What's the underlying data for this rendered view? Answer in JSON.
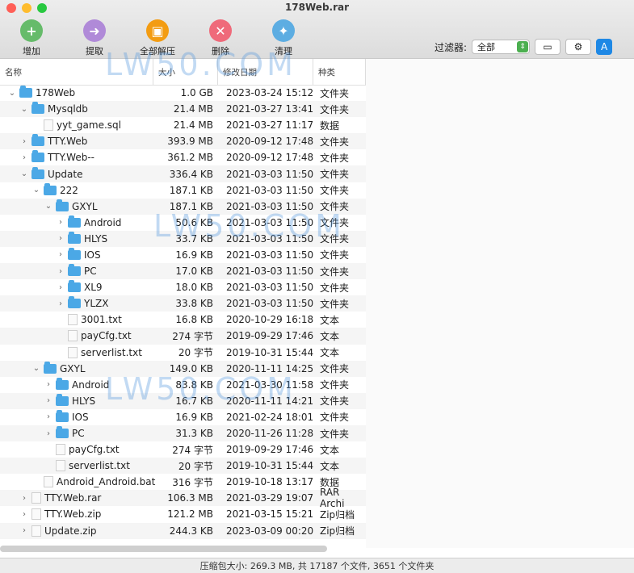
{
  "window": {
    "title": "178Web.rar"
  },
  "toolbar": {
    "items": [
      {
        "label": "增加",
        "icon": "add-icon",
        "color": "#66bb6a"
      },
      {
        "label": "提取",
        "icon": "extract-icon",
        "color": "#b08ad8"
      },
      {
        "label": "全部解压",
        "icon": "extract-all-icon",
        "color": "#f39c12"
      },
      {
        "label": "删除",
        "icon": "delete-icon",
        "color": "#ef6a7a"
      },
      {
        "label": "清理",
        "icon": "clean-icon",
        "color": "#5dade2"
      }
    ]
  },
  "filter": {
    "label": "过滤器:",
    "value": "全部"
  },
  "table": {
    "headers": [
      "名称",
      "大小",
      "修改日期",
      "种类"
    ],
    "rows": [
      {
        "name": "178Web",
        "size": "1.0 GB",
        "date": "2023-03-24 15:12",
        "type": "文件夹",
        "depth": 0,
        "kind": "folder",
        "chevron": "v"
      },
      {
        "name": "Mysqldb",
        "size": "21.4 MB",
        "date": "2021-03-27 13:41",
        "type": "文件夹",
        "depth": 1,
        "kind": "folder",
        "chevron": "v"
      },
      {
        "name": "yyt_game.sql",
        "size": "21.4 MB",
        "date": "2021-03-27 11:17",
        "type": "数据",
        "depth": 2,
        "kind": "file",
        "chevron": ""
      },
      {
        "name": "TTY.Web",
        "size": "393.9 MB",
        "date": "2020-09-12 17:48",
        "type": "文件夹",
        "depth": 1,
        "kind": "folder",
        "chevron": ">"
      },
      {
        "name": "TTY.Web--",
        "size": "361.2 MB",
        "date": "2020-09-12 17:48",
        "type": "文件夹",
        "depth": 1,
        "kind": "folder",
        "chevron": ">"
      },
      {
        "name": "Update",
        "size": "336.4 KB",
        "date": "2021-03-03 11:50",
        "type": "文件夹",
        "depth": 1,
        "kind": "folder",
        "chevron": "v"
      },
      {
        "name": "222",
        "size": "187.1 KB",
        "date": "2021-03-03 11:50",
        "type": "文件夹",
        "depth": 2,
        "kind": "folder",
        "chevron": "v"
      },
      {
        "name": "GXYL",
        "size": "187.1 KB",
        "date": "2021-03-03 11:50",
        "type": "文件夹",
        "depth": 3,
        "kind": "folder",
        "chevron": "v"
      },
      {
        "name": "Android",
        "size": "50.6 KB",
        "date": "2021-03-03 11:50",
        "type": "文件夹",
        "depth": 4,
        "kind": "folder",
        "chevron": ">"
      },
      {
        "name": "HLYS",
        "size": "33.7 KB",
        "date": "2021-03-03 11:50",
        "type": "文件夹",
        "depth": 4,
        "kind": "folder",
        "chevron": ">"
      },
      {
        "name": "IOS",
        "size": "16.9 KB",
        "date": "2021-03-03 11:50",
        "type": "文件夹",
        "depth": 4,
        "kind": "folder",
        "chevron": ">"
      },
      {
        "name": "PC",
        "size": "17.0 KB",
        "date": "2021-03-03 11:50",
        "type": "文件夹",
        "depth": 4,
        "kind": "folder",
        "chevron": ">"
      },
      {
        "name": "XL9",
        "size": "18.0 KB",
        "date": "2021-03-03 11:50",
        "type": "文件夹",
        "depth": 4,
        "kind": "folder",
        "chevron": ">"
      },
      {
        "name": "YLZX",
        "size": "33.8 KB",
        "date": "2021-03-03 11:50",
        "type": "文件夹",
        "depth": 4,
        "kind": "folder",
        "chevron": ">"
      },
      {
        "name": "3001.txt",
        "size": "16.8 KB",
        "date": "2020-10-29 16:18",
        "type": "文本",
        "depth": 4,
        "kind": "file",
        "chevron": ""
      },
      {
        "name": "payCfg.txt",
        "size": "274 字节",
        "date": "2019-09-29 17:46",
        "type": "文本",
        "depth": 4,
        "kind": "file",
        "chevron": ""
      },
      {
        "name": "serverlist.txt",
        "size": "20 字节",
        "date": "2019-10-31 15:44",
        "type": "文本",
        "depth": 4,
        "kind": "file",
        "chevron": ""
      },
      {
        "name": "GXYL",
        "size": "149.0 KB",
        "date": "2020-11-11 14:25",
        "type": "文件夹",
        "depth": 2,
        "kind": "folder",
        "chevron": "v"
      },
      {
        "name": "Android",
        "size": "83.8 KB",
        "date": "2021-03-30 11:58",
        "type": "文件夹",
        "depth": 3,
        "kind": "folder",
        "chevron": ">"
      },
      {
        "name": "HLYS",
        "size": "16.7 KB",
        "date": "2020-11-11 14:21",
        "type": "文件夹",
        "depth": 3,
        "kind": "folder",
        "chevron": ">"
      },
      {
        "name": "IOS",
        "size": "16.9 KB",
        "date": "2021-02-24 18:01",
        "type": "文件夹",
        "depth": 3,
        "kind": "folder",
        "chevron": ">"
      },
      {
        "name": "PC",
        "size": "31.3 KB",
        "date": "2020-11-26 11:28",
        "type": "文件夹",
        "depth": 3,
        "kind": "folder",
        "chevron": ">"
      },
      {
        "name": "payCfg.txt",
        "size": "274 字节",
        "date": "2019-09-29 17:46",
        "type": "文本",
        "depth": 3,
        "kind": "file",
        "chevron": ""
      },
      {
        "name": "serverlist.txt",
        "size": "20 字节",
        "date": "2019-10-31 15:44",
        "type": "文本",
        "depth": 3,
        "kind": "file",
        "chevron": ""
      },
      {
        "name": "Android_Android.bat",
        "size": "316 字节",
        "date": "2019-10-18 13:17",
        "type": "数据",
        "depth": 2,
        "kind": "file",
        "chevron": ""
      },
      {
        "name": "TTY.Web.rar",
        "size": "106.3 MB",
        "date": "2021-03-29 19:07",
        "type": "RAR Archi",
        "depth": 1,
        "kind": "file",
        "chevron": ">"
      },
      {
        "name": "TTY.Web.zip",
        "size": "121.2 MB",
        "date": "2021-03-15 15:21",
        "type": "Zip归档",
        "depth": 1,
        "kind": "file",
        "chevron": ">"
      },
      {
        "name": "Update.zip",
        "size": "244.3 KB",
        "date": "2023-03-09 00:20",
        "type": "Zip归档",
        "depth": 1,
        "kind": "file",
        "chevron": ">"
      }
    ]
  },
  "status": {
    "text": "压缩包大小: 269.3 MB, 共 17187 个文件, 3651 个文件夹"
  },
  "watermarks": [
    "LW50.COM",
    "LW50.COM",
    "LW50.COM"
  ]
}
